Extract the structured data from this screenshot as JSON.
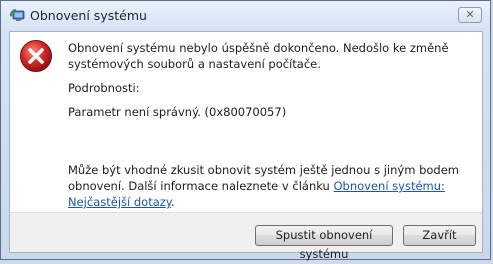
{
  "window": {
    "title": "Obnovení systému",
    "close_glyph": "✕"
  },
  "icons": {
    "title": "system-restore-icon",
    "message": "error-icon",
    "error_color": "#d42b2b"
  },
  "message": {
    "headline": "Obnovení systému nebylo úspěšně dokončeno. Nedošlo ke změně systémových souborů a nastavení počítače.",
    "details_label": "Podrobnosti:",
    "details_text": "Parametr není správný. (0x80070057)",
    "suggestion_text": "Může být vhodné zkusit obnovit systém ještě jednou s jiným bodem obnovení. Další informace naleznete v článku ",
    "suggestion_link": "Obnovení systému: Nejčastější dotazy",
    "suggestion_end": "."
  },
  "buttons": {
    "restore": "Spustit obnovení systému",
    "close": "Zavřít"
  }
}
